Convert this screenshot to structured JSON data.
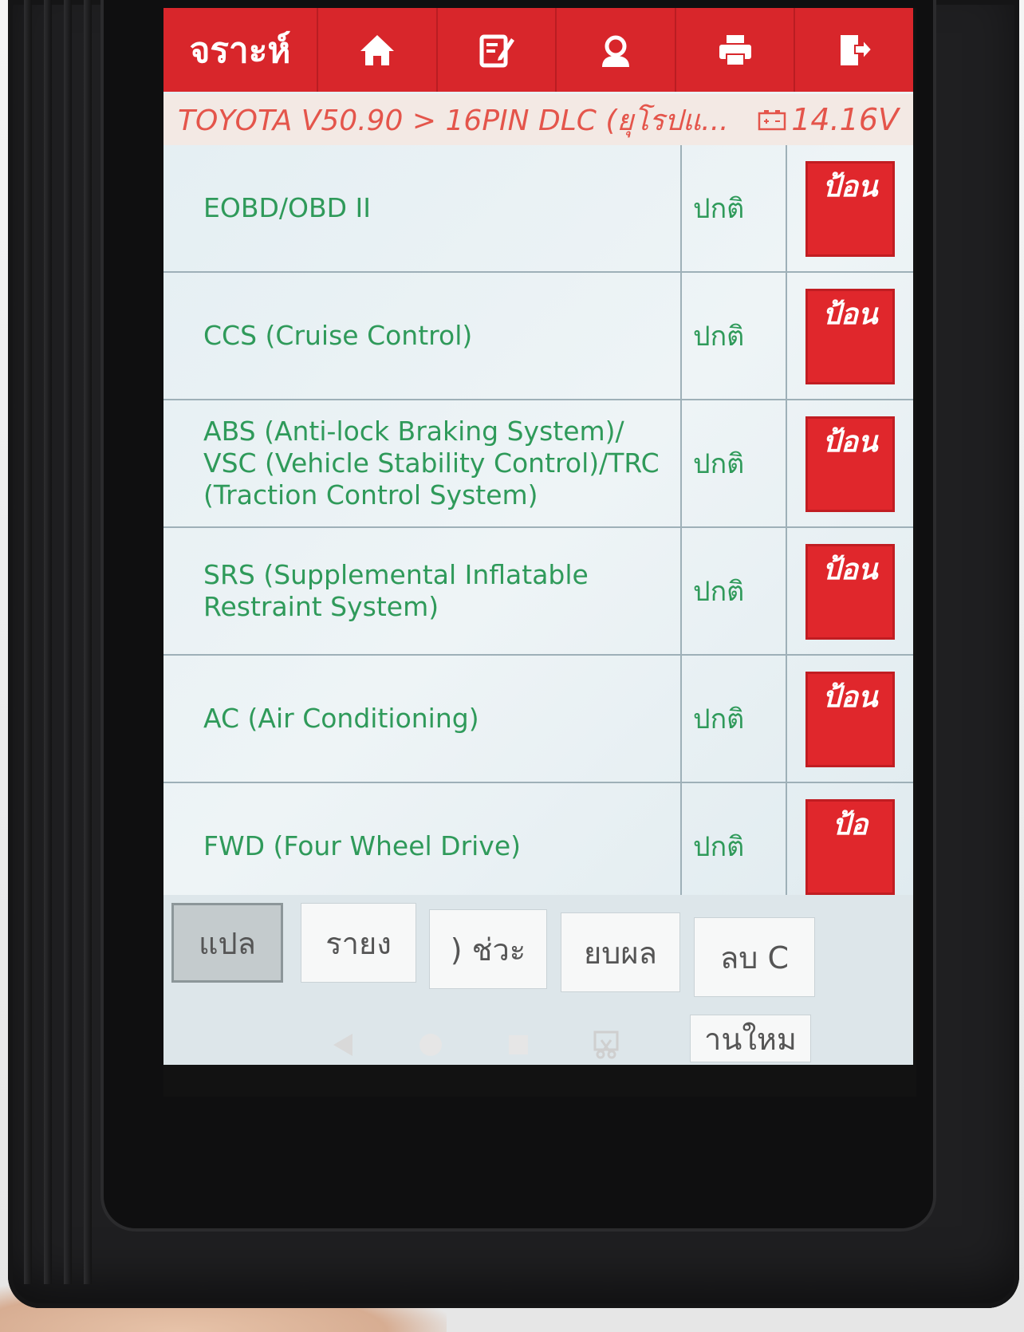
{
  "header": {
    "title": "จราะห์",
    "icons": [
      "home-icon",
      "edit-note-icon",
      "user-headset-icon",
      "printer-icon",
      "exit-icon"
    ]
  },
  "breadcrumb": {
    "path": "TOYOTA V50.90 > 16PIN DLC (ยุโรปแ...",
    "voltage": "14.16V"
  },
  "systems": [
    {
      "name": "EOBD/OBD II",
      "status": "ปกติ",
      "action": "ป้อน"
    },
    {
      "name": "CCS (Cruise Control)",
      "status": "ปกติ",
      "action": "ป้อน"
    },
    {
      "name": "ABS (Anti-lock Braking System)/ VSC (Vehicle Stability Control)/TRC (Traction Control System)",
      "status": "ปกติ",
      "action": "ป้อน"
    },
    {
      "name": "SRS (Supplemental Inflatable Restraint System)",
      "status": "ปกติ",
      "action": "ป้อน"
    },
    {
      "name": "AC (Air Conditioning)",
      "status": "ปกติ",
      "action": "ป้อน"
    },
    {
      "name": "FWD (Four Wheel Drive)",
      "status": "ปกติ",
      "action": "ป้อ"
    }
  ],
  "bottom_buttons": [
    "แปล",
    "รายง",
    ") ช่วะ",
    "ยบผล",
    "ลบ C",
    "านใหม"
  ],
  "nav": {
    "icons": [
      "back-icon",
      "home-circle-icon",
      "recents-square-icon",
      "screenshot-scissors-icon"
    ]
  }
}
